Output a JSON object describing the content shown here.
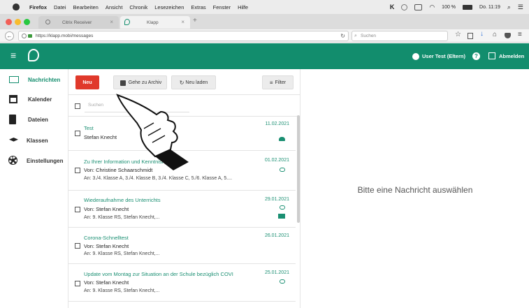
{
  "menubar": {
    "app": "Firefox",
    "items": [
      "Datei",
      "Bearbeiten",
      "Ansicht",
      "Chronik",
      "Lesezeichen",
      "Extras",
      "Fenster",
      "Hilfe"
    ],
    "battery": "100 %",
    "clock": "Do. 11:19"
  },
  "tabs": [
    {
      "title": "Citrix Receiver"
    },
    {
      "title": "Klapp"
    }
  ],
  "urlbar": {
    "url": "https://klapp.mobi/messages",
    "search_placeholder": "Suchen"
  },
  "appbar": {
    "user_label": "User Test (Eltern)",
    "help_label": "?",
    "logout_label": "Abmelden",
    "color": "#128d6d"
  },
  "sidebar": {
    "items": [
      {
        "label": "Nachrichten",
        "icon": "mail-icon",
        "active": true
      },
      {
        "label": "Kalender",
        "icon": "calendar-icon"
      },
      {
        "label": "Dateien",
        "icon": "file-icon"
      },
      {
        "label": "Klassen",
        "icon": "graduation-cap-icon"
      },
      {
        "label": "Einstellungen",
        "icon": "gear-icon"
      }
    ]
  },
  "toolbar": {
    "new_label": "Neu",
    "archive_label": "Gehe zu Archiv",
    "reload_label": "Neu laden",
    "filter_label": "Filter",
    "search_placeholder": "Suchen"
  },
  "messages": [
    {
      "subject": "Test",
      "from": "Stefan Knecht",
      "to": "",
      "date": "11.02.2021",
      "icons": [
        "group-icon"
      ]
    },
    {
      "subject": "Zu Ihrer Information und Kenntnisnahme",
      "from": "Von: Christine Schaarschmidt",
      "to": "An: 3./4. Klasse A, 3./4. Klasse B, 3./4. Klasse C, 5./6. Klasse A, 5....",
      "date": "01.02.2021",
      "icons": [
        "attachment-icon"
      ]
    },
    {
      "subject": "Wiederaufnahme des Unterrichts",
      "from": "Von: Stefan Knecht",
      "to": "An: 9. Klasse RS, Stefan Knecht,...",
      "date": "29.01.2021",
      "icons": [
        "attachment-icon",
        "mail-icon"
      ]
    },
    {
      "subject": "Corona-Schnelltest",
      "from": "Von: Stefan Knecht",
      "to": "An: 9. Klasse RS, Stefan Knecht,...",
      "date": "26.01.2021",
      "icons": []
    },
    {
      "subject": "Update vom Montag zur Situation an der Schule bezüglich COVI",
      "from": "Von: Stefan Knecht",
      "to": "An: 9. Klasse RS, Stefan Knecht,...",
      "date": "25.01.2021",
      "icons": [
        "attachment-icon"
      ]
    }
  ],
  "detail": {
    "empty_text": "Bitte eine Nachricht auswählen"
  }
}
